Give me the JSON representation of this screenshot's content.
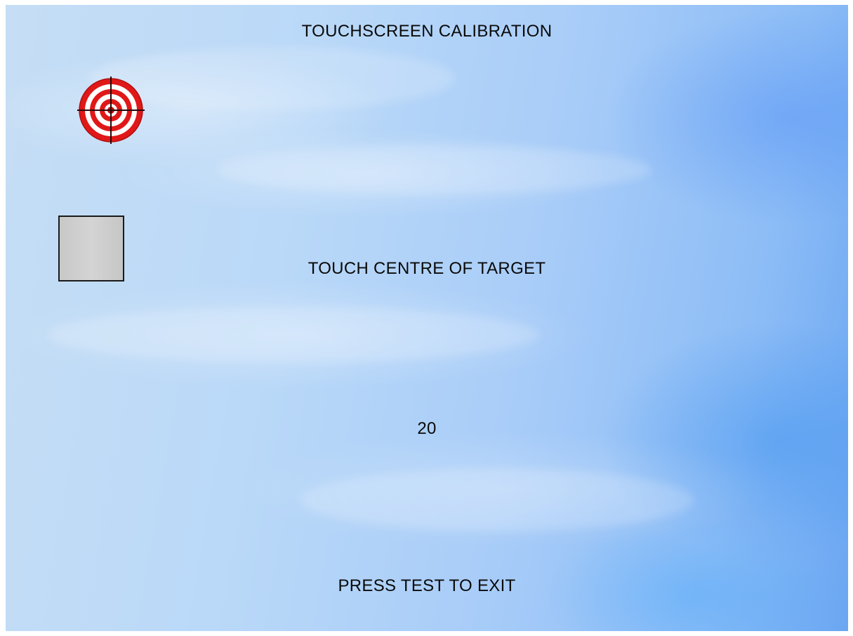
{
  "screen": {
    "title": "TOUCHSCREEN CALIBRATION",
    "instruction": "TOUCH CENTRE OF TARGET",
    "countdown": "20",
    "exit_hint": "PRESS TEST TO EXIT"
  },
  "icons": {
    "target": "crosshair-target-icon",
    "touch_area": "touch-area-box"
  },
  "colors": {
    "target_red": "#e01818",
    "target_white": "#ffffff",
    "crosshair": "#2a0a0a",
    "touch_box_fill": "#cccccc",
    "text": "#0a0a0a"
  }
}
